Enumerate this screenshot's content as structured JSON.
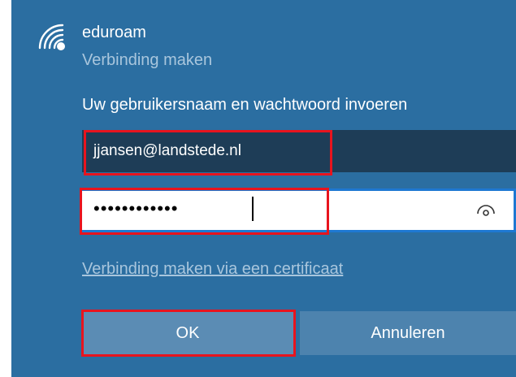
{
  "network": {
    "name": "eduroam",
    "status": "Verbinding maken",
    "icon": "wifi-secured-icon"
  },
  "form": {
    "prompt": "Uw gebruikersnaam en wachtwoord invoeren",
    "username_value": "jjansen@landstede.nl",
    "password_masked": "••••••••••••",
    "reveal_icon": "eye-icon",
    "certificate_link": "Verbinding maken via een certificaat"
  },
  "buttons": {
    "ok_label": "OK",
    "cancel_label": "Annuleren"
  },
  "colors": {
    "panel_bg": "#2b6ea1",
    "highlight": "#e8141e",
    "focus_border": "#1e78d2"
  }
}
